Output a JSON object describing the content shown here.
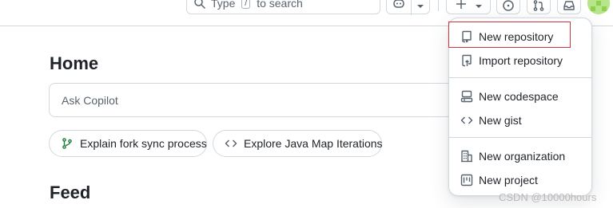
{
  "header": {
    "search": {
      "prefix": "Type ",
      "key": "/",
      "suffix": " to search",
      "icon": "search-icon"
    },
    "buttons": [
      {
        "name": "copilot-button",
        "icon": "copilot-icon"
      },
      {
        "name": "copilot-dropdown",
        "icon": "triangle-down-icon"
      },
      {
        "name": "create-new-button",
        "icon": "plus-icon"
      },
      {
        "name": "issues-button",
        "icon": "issue-opened-icon"
      },
      {
        "name": "pull-requests-button",
        "icon": "git-pull-request-icon"
      },
      {
        "name": "inbox-button",
        "icon": "inbox-icon"
      }
    ],
    "avatar": {
      "color": "#b7e58a"
    }
  },
  "main": {
    "home_title": "Home",
    "ask_placeholder": "Ask Copilot",
    "suggestions": [
      {
        "label": "Explain fork sync process",
        "icon": "git-branch-icon"
      },
      {
        "label": "Explore Java Map Iterations",
        "icon": "code-icon"
      }
    ],
    "feed_title": "Feed"
  },
  "create_menu": {
    "items": [
      {
        "label": "New repository",
        "icon": "repo-icon",
        "highlighted": true
      },
      {
        "label": "Import repository",
        "icon": "repo-push-icon"
      },
      {
        "label": "New codespace",
        "icon": "codespaces-icon"
      },
      {
        "label": "New gist",
        "icon": "code-icon"
      },
      {
        "label": "New organization",
        "icon": "organization-icon"
      },
      {
        "label": "New project",
        "icon": "project-icon"
      }
    ]
  },
  "colors": {
    "accent_highlight": "#d0363d",
    "border": "#d1d9e0",
    "text": "#1f2328",
    "muted": "#59636e"
  },
  "watermark": "CSDN @10000hours"
}
